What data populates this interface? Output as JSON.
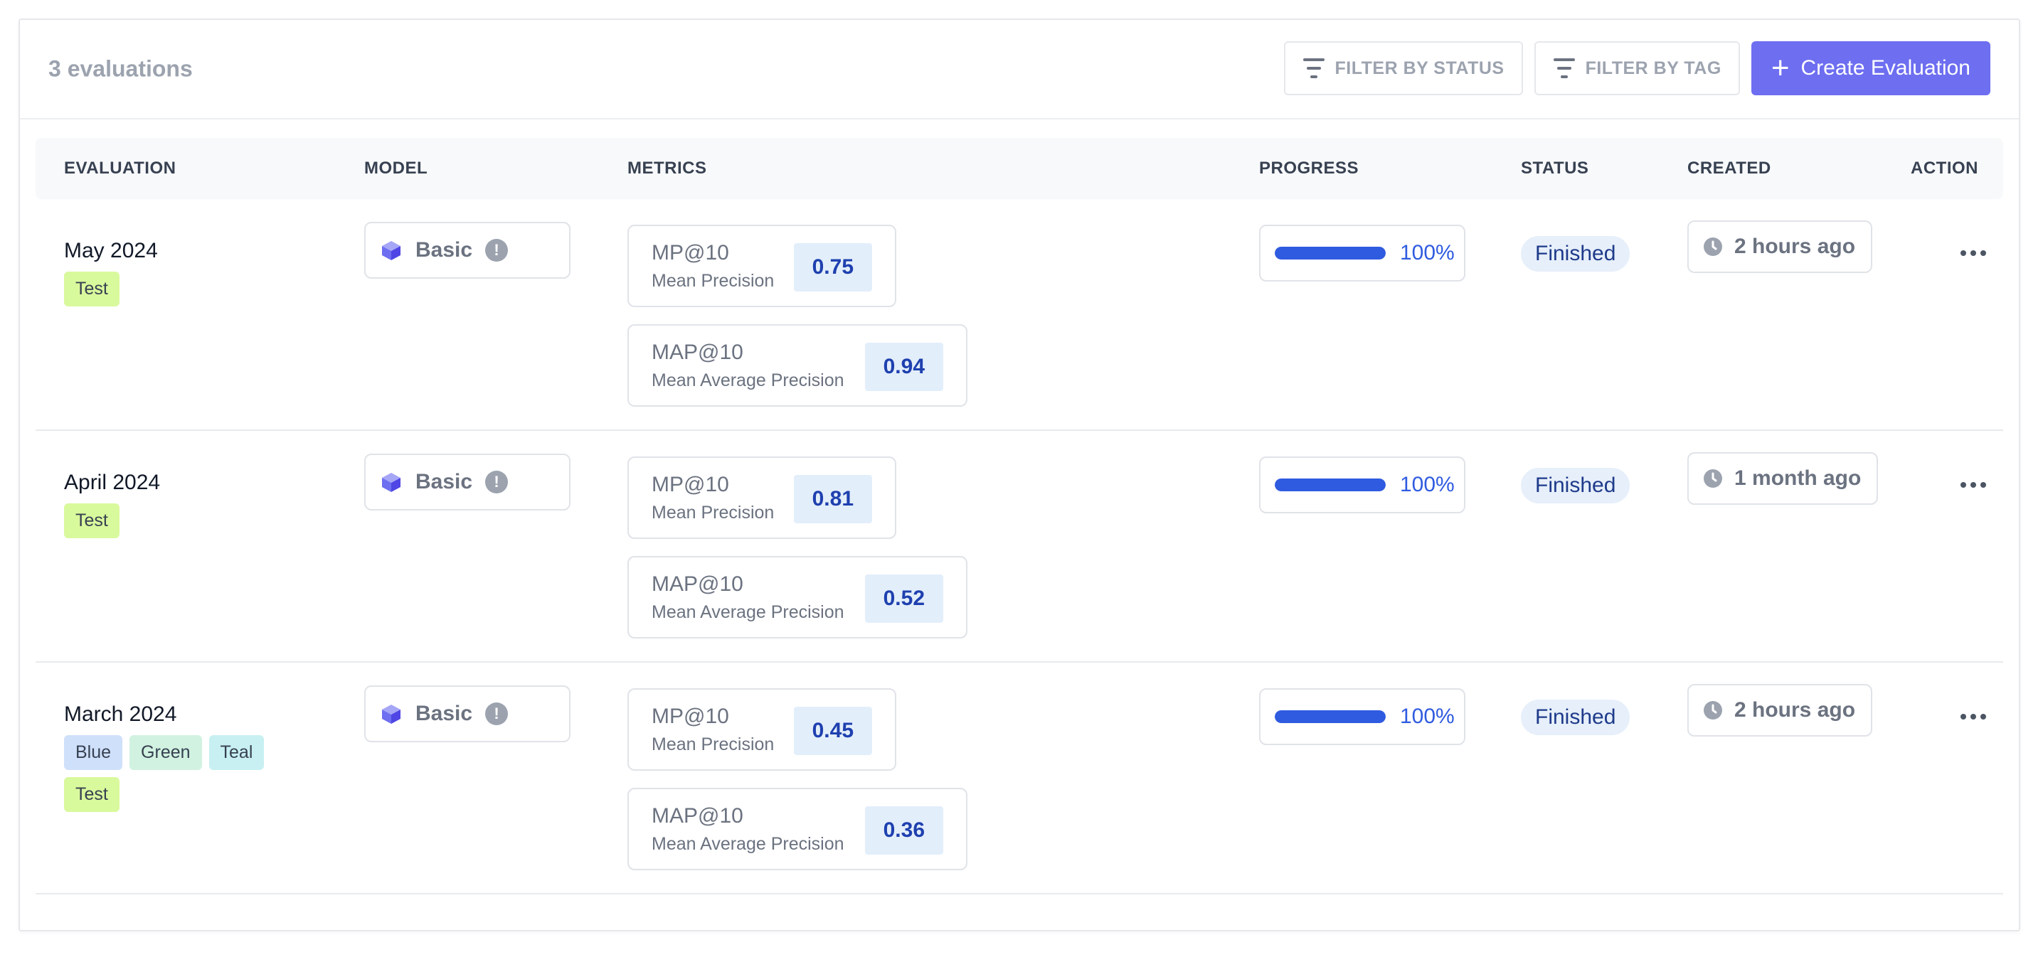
{
  "toolbar": {
    "count_label": "3 evaluations",
    "filter_status_label": "FILTER BY STATUS",
    "filter_tag_label": "FILTER BY TAG",
    "create_label": "Create Evaluation"
  },
  "headers": {
    "evaluation": "EVALUATION",
    "model": "MODEL",
    "metrics": "METRICS",
    "progress": "PROGRESS",
    "status": "STATUS",
    "created": "CREATED",
    "action": "ACTION"
  },
  "rows": [
    {
      "name": "May 2024",
      "tags": [
        {
          "label": "Test",
          "color": "#d9f99d"
        }
      ],
      "model": "Basic",
      "mp": {
        "name": "MP@10",
        "desc": "Mean Precision",
        "value": "0.75"
      },
      "map": {
        "name": "MAP@10",
        "desc": "Mean Average Precision",
        "value": "0.94"
      },
      "progress": "100%",
      "progress_fraction": 1.0,
      "status": "Finished",
      "created": "2 hours ago"
    },
    {
      "name": "April 2024",
      "tags": [
        {
          "label": "Test",
          "color": "#d9f99d"
        }
      ],
      "model": "Basic",
      "mp": {
        "name": "MP@10",
        "desc": "Mean Precision",
        "value": "0.81"
      },
      "map": {
        "name": "MAP@10",
        "desc": "Mean Average Precision",
        "value": "0.52"
      },
      "progress": "100%",
      "progress_fraction": 1.0,
      "status": "Finished",
      "created": "1 month ago"
    },
    {
      "name": "March 2024",
      "tags": [
        {
          "label": "Blue",
          "color": "#cfe0fb"
        },
        {
          "label": "Green",
          "color": "#d1f2e1"
        },
        {
          "label": "Teal",
          "color": "#c8f0f2"
        },
        {
          "label": "Test",
          "color": "#d9f99d"
        }
      ],
      "model": "Basic",
      "mp": {
        "name": "MP@10",
        "desc": "Mean Precision",
        "value": "0.45"
      },
      "map": {
        "name": "MAP@10",
        "desc": "Mean Average Precision",
        "value": "0.36"
      },
      "progress": "100%",
      "progress_fraction": 1.0,
      "status": "Finished",
      "created": "2 hours ago"
    }
  ],
  "icons": {
    "filter": "filter-icon",
    "plus": "plus-icon",
    "model": "cube-icon",
    "info": "info-icon",
    "clock": "clock-icon",
    "more": "more-horizontal-icon"
  },
  "colors": {
    "accent": "#6d6ef0",
    "progress": "#2f5be0",
    "metric_value_bg": "#e3eefb",
    "status_bg": "#e6effa"
  }
}
